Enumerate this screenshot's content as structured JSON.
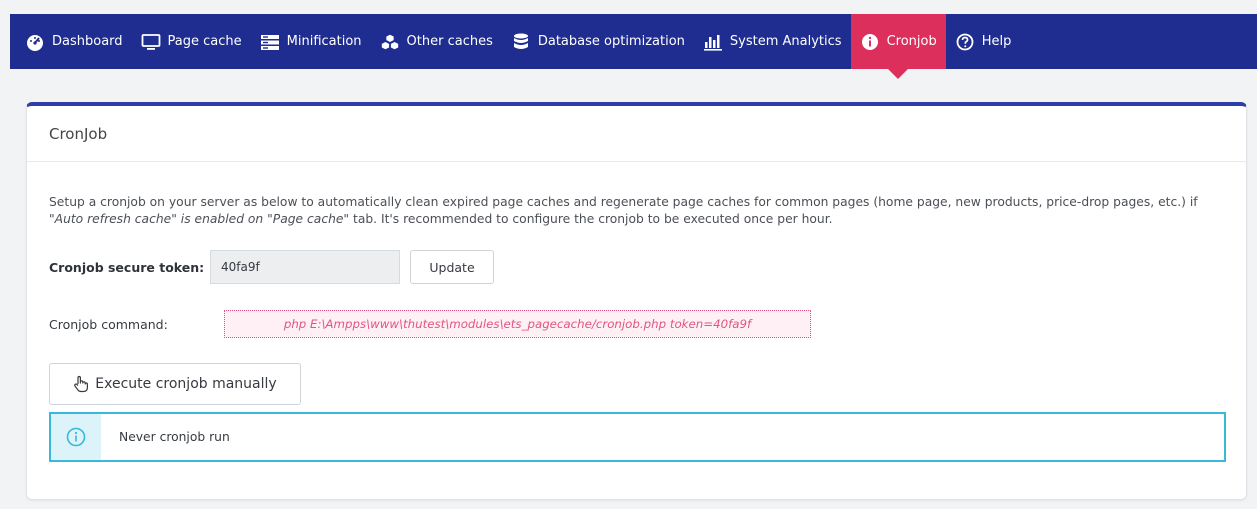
{
  "nav": {
    "items": [
      {
        "label": "Dashboard",
        "icon": "dashboard-icon"
      },
      {
        "label": "Page cache",
        "icon": "monitor-icon"
      },
      {
        "label": "Minification",
        "icon": "server-icon"
      },
      {
        "label": "Other caches",
        "icon": "cubes-icon"
      },
      {
        "label": "Database optimization",
        "icon": "database-icon"
      },
      {
        "label": "System Analytics",
        "icon": "bar-chart-icon"
      },
      {
        "label": "Cronjob",
        "icon": "info-icon",
        "active": true
      },
      {
        "label": "Help",
        "icon": "help-icon"
      }
    ],
    "colors": {
      "background": "#1e2d8f",
      "active": "#dc2f5c"
    }
  },
  "panel": {
    "title": "CronJob",
    "description": {
      "part1": "Setup a cronjob on your server as below to automatically clean expired page caches and regenerate page caches for common pages (home page, new products, price-drop pages, etc.) if ",
      "emphasis": "\"Auto refresh cache\" is enabled on \"Page cache\"",
      "part2": " tab. It's recommended to configure the cronjob to be executed once per hour."
    },
    "token": {
      "label": "Cronjob secure token:",
      "value": "40fa9f",
      "button": "Update"
    },
    "command": {
      "label": "Cronjob command:",
      "value": "php E:\\Ampps\\www\\thutest\\modules\\ets_pagecache/cronjob.php token=40fa9f"
    },
    "execute_button": "Execute cronjob manually",
    "alert": {
      "text": "Never cronjob run",
      "color": "#3ab8d9"
    }
  }
}
